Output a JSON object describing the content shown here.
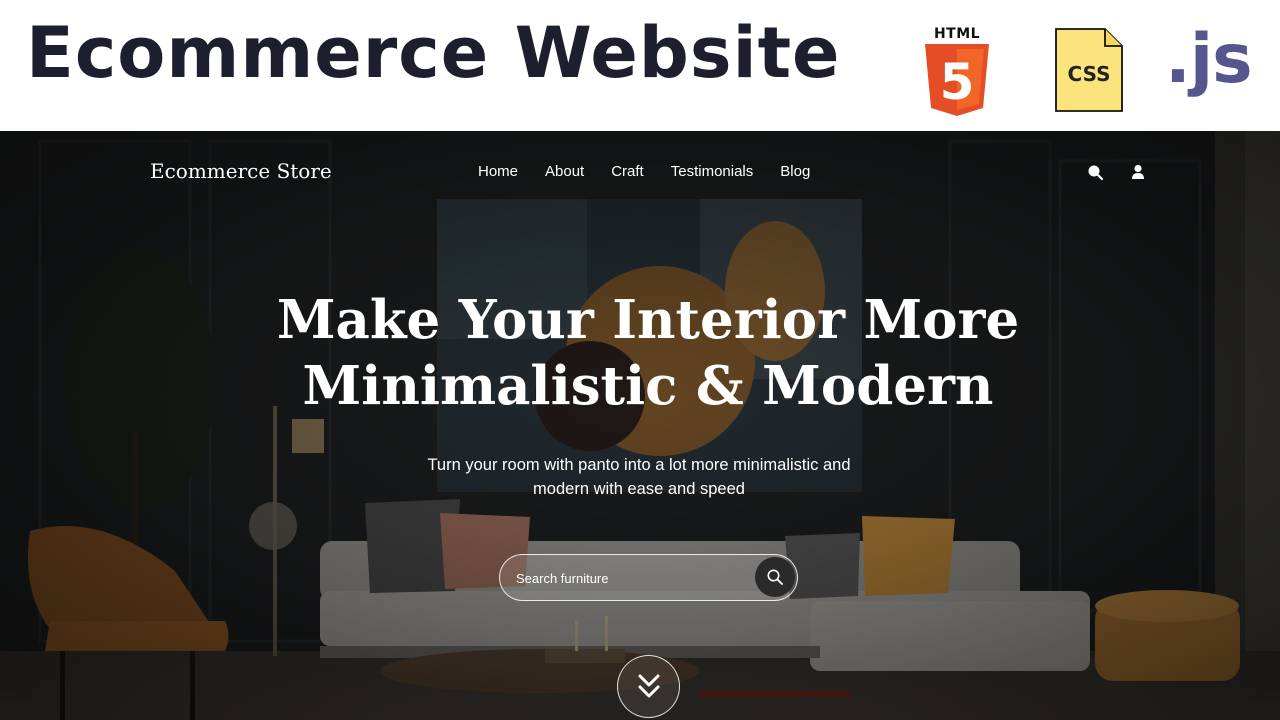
{
  "banner": {
    "title": "Ecommerce Website",
    "html_logo_text": "HTML",
    "html_logo_number": "5",
    "css_logo_text": "CSS",
    "js_logo_text": ".js",
    "colors": {
      "title": "#1d1f2e",
      "html": "#e44d26",
      "css_file": "#fbe37d",
      "js": "#56568e"
    }
  },
  "site": {
    "brand": "Ecommerce Store",
    "nav_links": [
      "Home",
      "About",
      "Craft",
      "Testimonials",
      "Blog"
    ],
    "nav_icons": [
      "search-icon",
      "user-icon"
    ]
  },
  "hero": {
    "headline_line1": "Make Your Interior More",
    "headline_line2": "Minimalistic & Modern",
    "subtext_line1": "Turn your room with panto into a lot more minimalistic and",
    "subtext_line2": "modern with ease and speed",
    "search": {
      "placeholder": "Search furniture",
      "button_icon": "search-icon"
    },
    "scroll_icon": "double-chevron-down-icon"
  }
}
